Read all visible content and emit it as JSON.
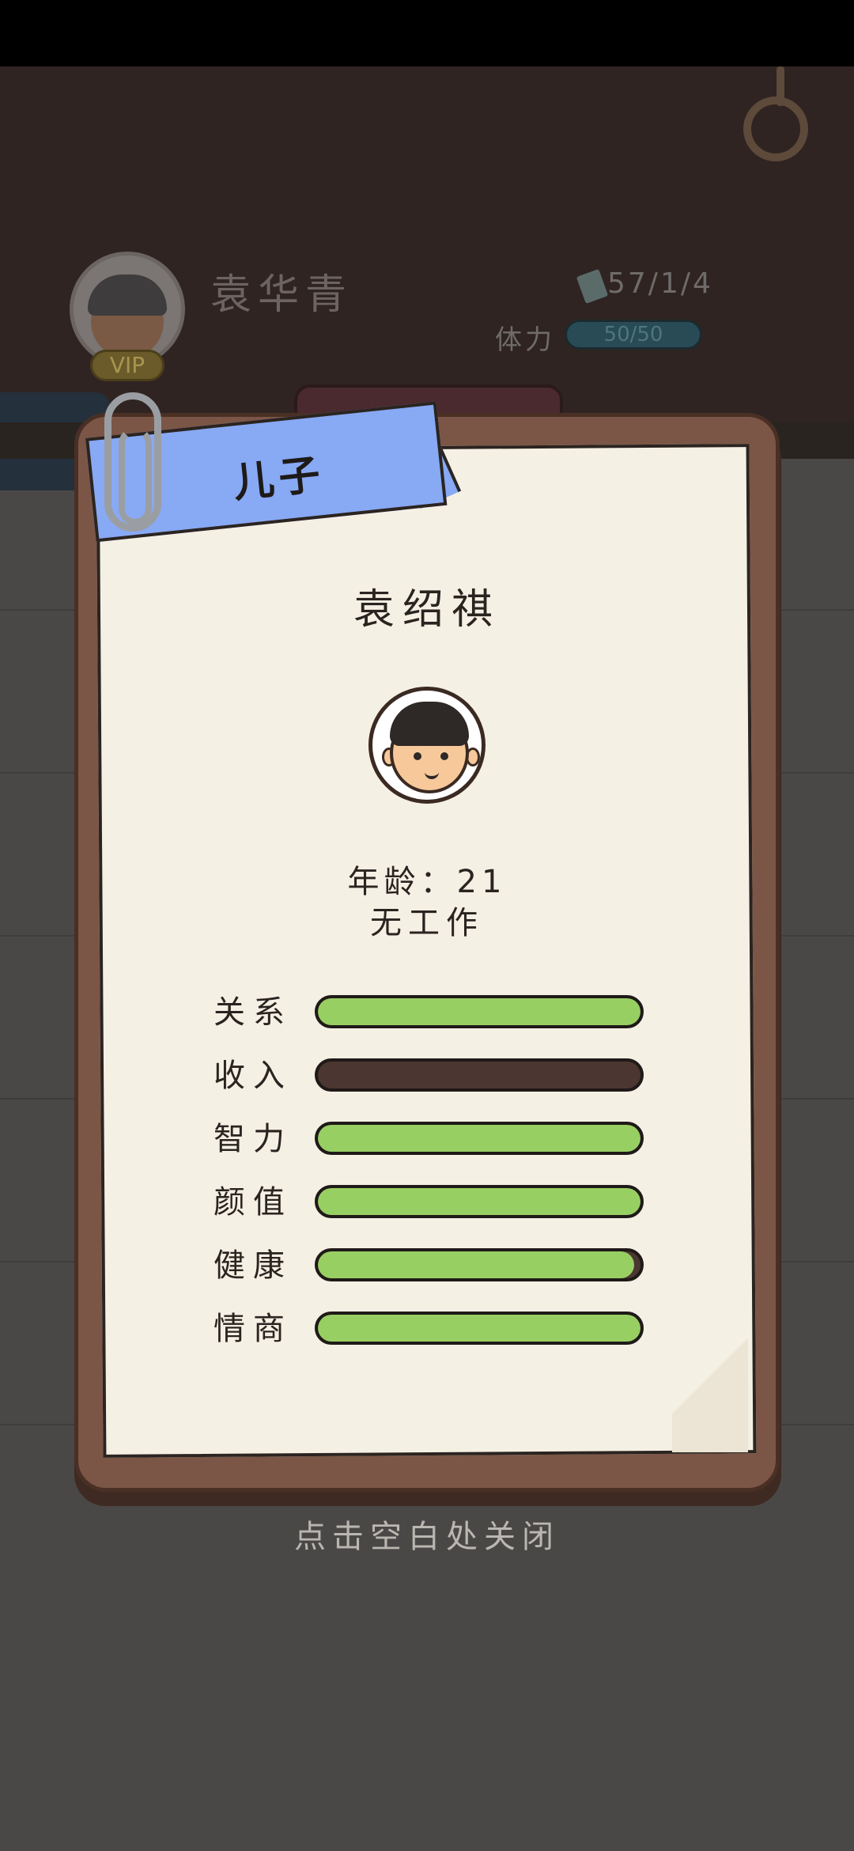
{
  "header": {
    "player_name": "袁华青",
    "vip_label": "VIP",
    "money": "57/1/4",
    "stamina_label": "体力",
    "stamina_value": "50/50"
  },
  "card": {
    "relation_tag": "儿子",
    "name": "袁绍祺",
    "age_text": "年龄：21",
    "job_text": "无工作",
    "stats": [
      {
        "label": "关系",
        "value": 1.0
      },
      {
        "label": "收入",
        "value": 0.0
      },
      {
        "label": "智力",
        "value": 1.0
      },
      {
        "label": "颜值",
        "value": 1.0
      },
      {
        "label": "健康",
        "value": 0.98
      },
      {
        "label": "情商",
        "value": 1.0
      }
    ]
  },
  "close_hint": "点击空白处关闭",
  "colors": {
    "stat_fill": "#98cf63",
    "stat_empty": "#4b3631",
    "ribbon": "#88a9f4",
    "board": "#7b5646",
    "paper": "#f5f0e4"
  }
}
